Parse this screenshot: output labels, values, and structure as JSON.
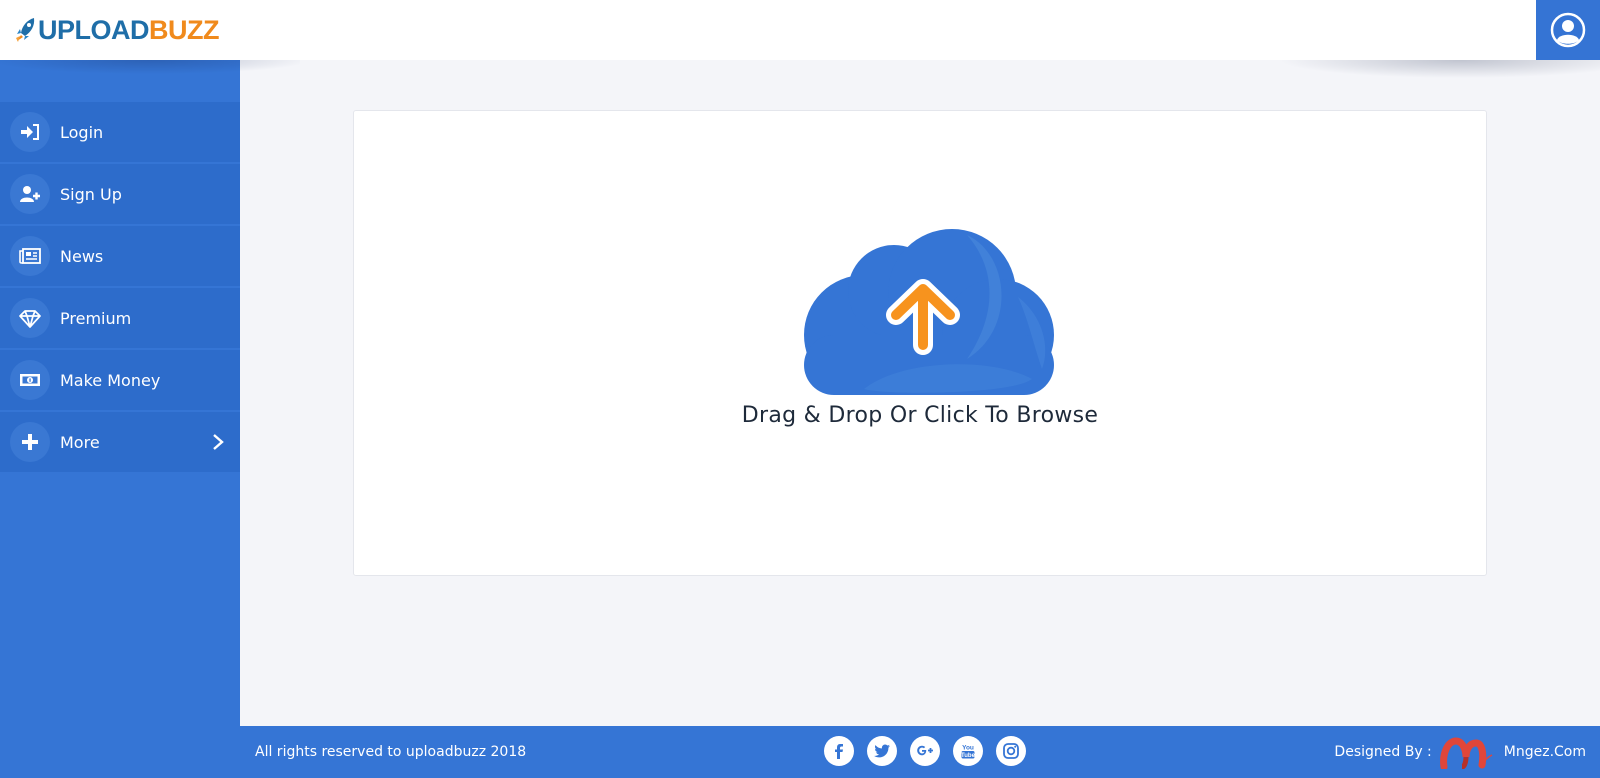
{
  "header": {
    "logo_part1": "UPLOAD",
    "logo_part2": "BUZZ",
    "logo_icon": "rocket-icon",
    "user_icon": "user-circle-icon"
  },
  "sidebar": {
    "items": [
      {
        "label": "Login",
        "icon": "sign-in-icon"
      },
      {
        "label": "Sign Up",
        "icon": "user-plus-icon"
      },
      {
        "label": "News",
        "icon": "newspaper-icon"
      },
      {
        "label": "Premium",
        "icon": "diamond-icon"
      },
      {
        "label": "Make Money",
        "icon": "money-bill-icon"
      },
      {
        "label": "More",
        "icon": "plus-icon",
        "has_submenu": true
      }
    ]
  },
  "upload": {
    "prompt": "Drag & Drop Or Click To Browse",
    "icon": "cloud-upload-icon"
  },
  "footer": {
    "copyright": "All rights reserved to uploadbuzz 2018",
    "socials": [
      {
        "name": "facebook",
        "icon": "facebook-icon"
      },
      {
        "name": "twitter",
        "icon": "twitter-icon"
      },
      {
        "name": "google-plus",
        "icon": "google-plus-icon"
      },
      {
        "name": "youtube",
        "icon": "youtube-icon"
      },
      {
        "name": "instagram",
        "icon": "instagram-icon"
      }
    ],
    "designed_by_label": "Designed By :",
    "designer_name": "Mngez.Com"
  },
  "colors": {
    "primary": "#3575d5",
    "sidebar_item": "#2d6ccb",
    "accent_orange": "#f08a1c",
    "logo_blue": "#1f6ea8",
    "background": "#f4f5f9"
  }
}
